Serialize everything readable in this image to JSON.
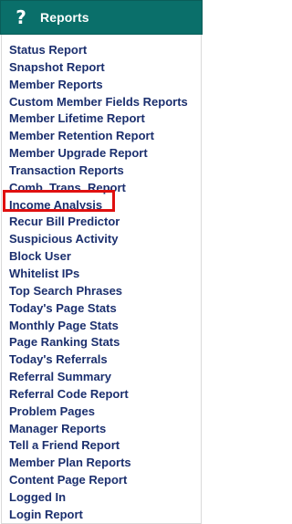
{
  "header": {
    "icon": "help-icon",
    "icon_glyph": "?",
    "title": "Reports",
    "background": "#0a6f6a"
  },
  "menu": {
    "items": [
      "Status Report",
      "Snapshot Report",
      "Member Reports",
      "Custom Member Fields Reports",
      "Member Lifetime Report",
      "Member Retention Report",
      "Member Upgrade Report",
      "Transaction Reports",
      "Comb. Trans. Report",
      "Income Analysis",
      "Recur Bill Predictor",
      "Suspicious Activity",
      "Block User",
      "Whitelist IPs",
      "Top Search Phrases",
      "Today's Page Stats",
      "Monthly Page Stats",
      "Page Ranking Stats",
      "Today's Referrals",
      "Referral Summary",
      "Referral Code Report",
      "Problem Pages",
      "Manager Reports",
      "Tell a Friend Report",
      "Member Plan Reports",
      "Content Page Report",
      "Logged In",
      "Login Report"
    ],
    "highlighted_item": "Income Analysis",
    "link_color": "#1b2f6e",
    "highlight_color": "#e01010"
  }
}
